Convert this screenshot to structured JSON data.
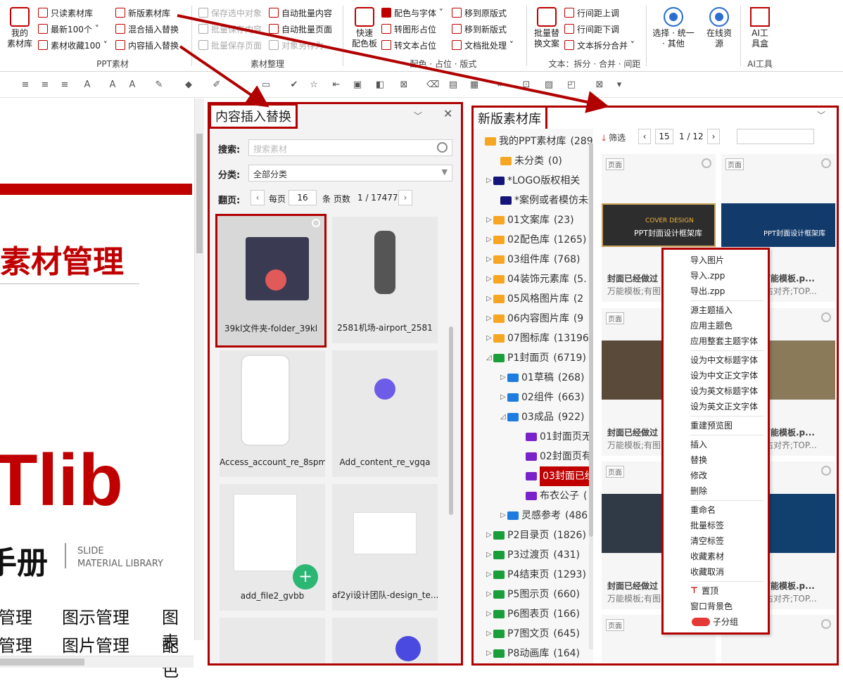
{
  "ribbon": {
    "my_library": "我的\n素材库",
    "col1": [
      "只读素材库",
      "最新100个",
      "素材收藏100"
    ],
    "col2": [
      "新版素材库",
      "混合插入替换",
      "内容插入替换"
    ],
    "group1": "PPT素材",
    "col3": [
      "保存选中对象",
      "批量保存内容",
      "批量保存页面"
    ],
    "col4": [
      "自动批量内容",
      "自动批量页面",
      "对象另存为..."
    ],
    "group2": "素材整理",
    "quick_palette": "快速\n配色板",
    "col5": [
      "配色与字体",
      "转图形占位",
      "转文本占位"
    ],
    "col6": [
      "移到原版式",
      "移到新版式",
      "文档批处理"
    ],
    "group3": "配色 · 占位 · 版式",
    "batch_replace": "批量替\n换文案",
    "col7": [
      "行间距上调",
      "行间距下调",
      "文本拆分合并"
    ],
    "group4": "文本：拆分 · 合并 · 间距",
    "select_unify": "选择 · 统一\n· 其他",
    "online": "在线资\n源",
    "ai_tools": "AI工\n具盒",
    "group5": "AI工具"
  },
  "slide": {
    "heading": "素材管理",
    "brand": "Tlib",
    "manual": "手册",
    "slide_en": "SLIDE",
    "material_en": "MATERIAL LIBRARY",
    "row1": [
      "管理",
      "图示管理",
      "图表"
    ],
    "row2": [
      "管理",
      "图片管理",
      "配色"
    ]
  },
  "insert_panel": {
    "title": "内容插入替换",
    "search_label": "搜索:",
    "search_placeholder": "搜索素材",
    "category_label": "分类:",
    "category_value": "全部分类",
    "page_label": "翻页:",
    "per_page": "每页",
    "per_page_value": "16",
    "items_pages": "条 页数",
    "page_count": "1 / 17477",
    "items": [
      "39kl文件夹-folder_39kl",
      "2581机场-airport_2581",
      "Access_account_re_8spm",
      "Add_content_re_vgqa",
      "add_file2_gvbb",
      "af2yi设计团队-design_te..."
    ]
  },
  "lib_panel": {
    "title": "新版素材库",
    "filter": "筛选",
    "page_input": "15",
    "page_count": "1 / 12",
    "tree": [
      {
        "label": "我的PPT素材库",
        "count": "(289"
      },
      {
        "label": "未分类",
        "count": "(0)"
      },
      {
        "label": "*LOGO版权相关",
        "count": ""
      },
      {
        "label": "*案例或者模仿未登",
        "count": ""
      },
      {
        "label": "01文案库",
        "count": "(23)"
      },
      {
        "label": "02配色库",
        "count": "(1265)"
      },
      {
        "label": "03组件库",
        "count": "(768)"
      },
      {
        "label": "04装饰元素库",
        "count": "(5."
      },
      {
        "label": "05风格图片库",
        "count": "(2"
      },
      {
        "label": "06内容图片库",
        "count": "(9"
      },
      {
        "label": "07图标库",
        "count": "(13196"
      },
      {
        "label": "P1封面页",
        "count": "(6719)"
      },
      {
        "label": "01草稿",
        "count": "(268)"
      },
      {
        "label": "02组件",
        "count": "(663)"
      },
      {
        "label": "03成品",
        "count": "(922)"
      },
      {
        "label": "01封面页无",
        "count": ""
      },
      {
        "label": "02封面页有",
        "count": ""
      },
      {
        "label": "03封面已经",
        "count": ""
      },
      {
        "label": "布衣公子",
        "count": "("
      },
      {
        "label": "灵感参考",
        "count": "(486"
      },
      {
        "label": "P2目录页",
        "count": "(1826)"
      },
      {
        "label": "P3过渡页",
        "count": "(431)"
      },
      {
        "label": "P4结束页",
        "count": "(1293)"
      },
      {
        "label": "P5图示页",
        "count": "(660)"
      },
      {
        "label": "P6图表页",
        "count": "(166)"
      },
      {
        "label": "P7图文页",
        "count": "(645)"
      },
      {
        "label": "P8动画库",
        "count": "(164)"
      }
    ],
    "tag": "页面",
    "card_title_left": "封面已经做过",
    "card_title_right": "过万能模板.p...",
    "card_sub_left": "万能模板;有图",
    "card_sub_right": "图;右对齐;TOP...",
    "thumb1_title": "PPT封面设计框架库",
    "thumb1_sub": "COVER DESIGN"
  },
  "context_menu": [
    "导入图片",
    "导入.zpp",
    "导出.zpp",
    "源主题插入",
    "应用主题色",
    "应用整套主题字体",
    "设为中文标题字体",
    "设为中文正文字体",
    "设为英文标题字体",
    "设为英文正文字体",
    "重建预览图",
    "插入",
    "替换",
    "修改",
    "删除",
    "重命名",
    "批量标签",
    "清空标签",
    "收藏素材",
    "收藏取消",
    "置顶",
    "窗口背景色",
    "子分组"
  ],
  "colors": {
    "accent": "#b00000",
    "brand_red": "#c00000",
    "folder_orange": "#f6a623",
    "folder_green": "#1a9e3a",
    "folder_blue": "#1e7be0",
    "folder_purple": "#7a22c9",
    "folder_navy": "#14147a"
  }
}
